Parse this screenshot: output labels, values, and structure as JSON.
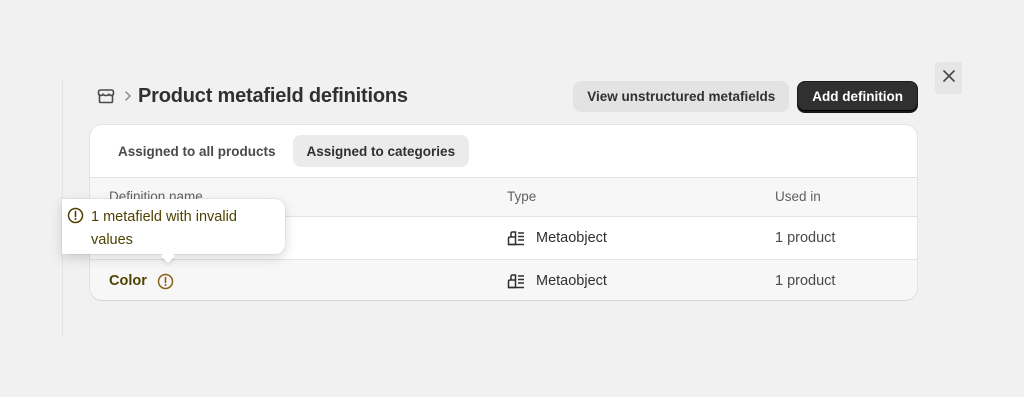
{
  "header": {
    "title": "Product metafield definitions",
    "breadcrumb_icon": "store-icon",
    "separator_icon": "chevron-right-icon"
  },
  "actions": {
    "secondary_label": "View unstructured metafields",
    "primary_label": "Add definition"
  },
  "close_icon": "close-icon",
  "tabs": [
    {
      "label": "Assigned to all products",
      "active": false
    },
    {
      "label": "Assigned to categories",
      "active": true
    }
  ],
  "table": {
    "columns": [
      "Definition name",
      "Type",
      "Used in"
    ],
    "rows": [
      {
        "name": "",
        "type": "Metaobject",
        "used_in": "1 product"
      },
      {
        "name": "Color",
        "type": "Metaobject",
        "used_in": "1 product",
        "warning": true
      }
    ]
  },
  "tooltip": {
    "text": "1 metafield with invalid values",
    "icon": "alert-circle-icon"
  },
  "colors": {
    "warning": "#4f4100",
    "warning_icon": "#8a6116",
    "primary_button": "#303030",
    "background": "#f1f1f1"
  }
}
